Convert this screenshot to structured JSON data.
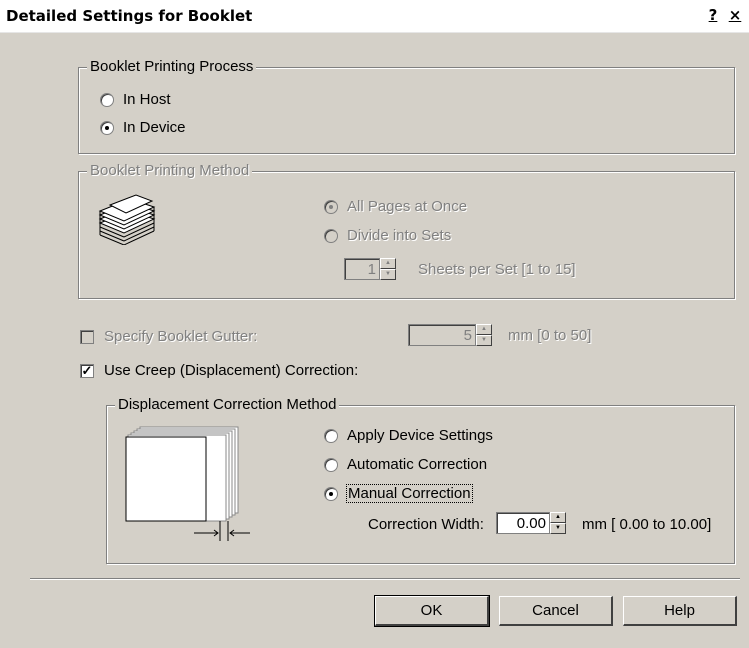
{
  "window": {
    "title": "Detailed Settings for Booklet",
    "help_button": "?",
    "close_button": "×"
  },
  "process_group": {
    "legend": "Booklet Printing Process",
    "options": [
      {
        "label": "In Host",
        "selected": false
      },
      {
        "label": "In Device",
        "selected": true
      }
    ]
  },
  "method_group": {
    "legend": "Booklet Printing Method",
    "icon": "booklet-stack-icon",
    "options": [
      {
        "label": "All Pages at Once",
        "selected": true
      },
      {
        "label": "Divide into Sets",
        "selected": false
      }
    ],
    "sheets_value": "1",
    "sheets_label": "Sheets per Set [1 to 15]"
  },
  "gutter": {
    "label": "Specify Booklet Gutter:",
    "checked": false,
    "value": "5",
    "unit": "mm [0 to 50]"
  },
  "creep": {
    "label": "Use Creep (Displacement) Correction:",
    "checked": true
  },
  "displacement_group": {
    "legend": "Displacement Correction Method",
    "options": [
      {
        "label": "Apply Device Settings",
        "selected": false
      },
      {
        "label": "Automatic Correction",
        "selected": false
      },
      {
        "label": "Manual Correction",
        "selected": true
      }
    ],
    "width_label": "Correction Width:",
    "width_value": "0.00",
    "width_unit": "mm [ 0.00 to  10.00]"
  },
  "buttons": {
    "ok": "OK",
    "cancel": "Cancel",
    "help": "Help"
  }
}
